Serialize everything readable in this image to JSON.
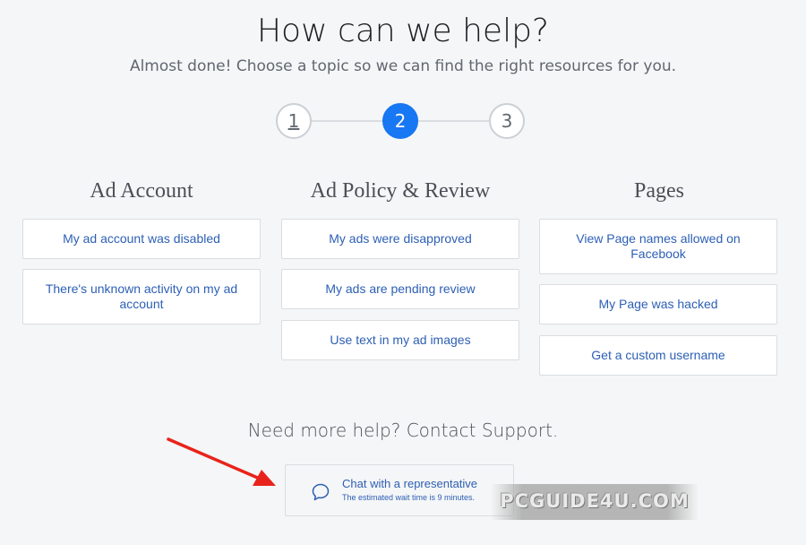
{
  "header": {
    "title": "How can we help?",
    "subtitle": "Almost done! Choose a topic so we can find the right resources for you."
  },
  "stepper": {
    "steps": [
      "1",
      "2",
      "3"
    ],
    "active_step": 2,
    "accent_color": "#1877f2"
  },
  "columns": [
    {
      "title": "Ad Account",
      "items": [
        "My ad account was disabled",
        "There's unknown activity on my ad account"
      ]
    },
    {
      "title": "Ad Policy & Review",
      "items": [
        "My ads were disapproved",
        "My ads are pending review",
        "Use text in my ad images"
      ]
    },
    {
      "title": "Pages",
      "items": [
        "View Page names allowed on Facebook",
        "My Page was hacked",
        "Get a custom username"
      ]
    }
  ],
  "support": {
    "heading": "Need more help? Contact Support.",
    "chat_label": "Chat with a representative",
    "wait_text": "The estimated wait time is 9 minutes.",
    "chat_icon": "chat-bubble-icon"
  },
  "annotation": {
    "arrow_color": "#e8231b"
  },
  "watermark": {
    "text": "PCGUIDE4U.COM"
  }
}
